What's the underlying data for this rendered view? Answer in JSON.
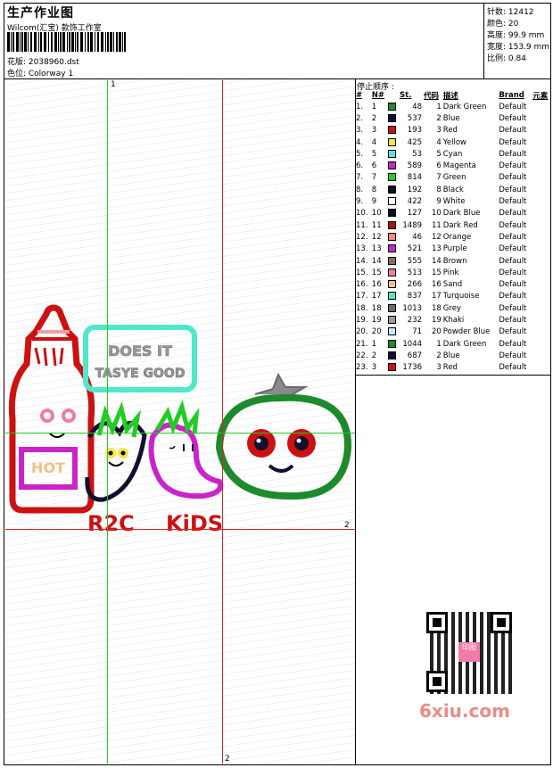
{
  "header": {
    "title": "生产作业图",
    "company": "Wilcom(汇宝) 款饰工作室",
    "design_label": "花版: 2038960.dst",
    "colorway_label": "色位: Colorway 1"
  },
  "stats": {
    "stitches": "针数: 12412",
    "colors": "颜色: 20",
    "height": "高度: 99.9 mm",
    "width": "宽度: 153.9 mm",
    "scale": "比例: 0.84"
  },
  "guides": {
    "green_v_label": "1",
    "red_h_label": "2",
    "red_v_label": "2"
  },
  "artwork": {
    "bottle_text": "HOT",
    "bubble_line1": "DOES IT",
    "bubble_line2": "TASYE GOOD",
    "brand_left": "R2C",
    "brand_right": "KiDS"
  },
  "stop_sequence": {
    "title": "停止顺序 :",
    "headers": [
      "#",
      "N#",
      "St.",
      "代码",
      "描述",
      "Brand",
      "元素"
    ],
    "rows": [
      {
        "idx": "1.",
        "n": "1",
        "color": "#1e8a2e",
        "st": "48",
        "code": "1",
        "desc": "Dark Green",
        "brand": "Default"
      },
      {
        "idx": "2.",
        "n": "2",
        "color": "#101030",
        "st": "537",
        "code": "2",
        "desc": "Blue",
        "brand": "Default"
      },
      {
        "idx": "3.",
        "n": "3",
        "color": "#cc1111",
        "st": "193",
        "code": "3",
        "desc": "Red",
        "brand": "Default"
      },
      {
        "idx": "4.",
        "n": "4",
        "color": "#f5e63c",
        "st": "425",
        "code": "4",
        "desc": "Yellow",
        "brand": "Default"
      },
      {
        "idx": "5.",
        "n": "5",
        "color": "#4fe8d8",
        "st": "53",
        "code": "5",
        "desc": "Cyan",
        "brand": "Default"
      },
      {
        "idx": "6.",
        "n": "6",
        "color": "#cc22cc",
        "st": "589",
        "code": "6",
        "desc": "Magenta",
        "brand": "Default"
      },
      {
        "idx": "7.",
        "n": "7",
        "color": "#22cc22",
        "st": "814",
        "code": "7",
        "desc": "Green",
        "brand": "Default"
      },
      {
        "idx": "8.",
        "n": "8",
        "color": "#111122",
        "st": "192",
        "code": "8",
        "desc": "Black",
        "brand": "Default"
      },
      {
        "idx": "9.",
        "n": "9",
        "color": "#ffffff",
        "st": "422",
        "code": "9",
        "desc": "White",
        "brand": "Default"
      },
      {
        "idx": "10.",
        "n": "10",
        "color": "#0c0c2a",
        "st": "127",
        "code": "10",
        "desc": "Dark Blue",
        "brand": "Default"
      },
      {
        "idx": "11.",
        "n": "11",
        "color": "#aa1111",
        "st": "1489",
        "code": "11",
        "desc": "Dark Red",
        "brand": "Default"
      },
      {
        "idx": "12.",
        "n": "12",
        "color": "#f08a78",
        "st": "46",
        "code": "12",
        "desc": "Orange",
        "brand": "Default"
      },
      {
        "idx": "13.",
        "n": "13",
        "color": "#cc22cc",
        "st": "521",
        "code": "13",
        "desc": "Purple",
        "brand": "Default"
      },
      {
        "idx": "14.",
        "n": "14",
        "color": "#8a6a58",
        "st": "555",
        "code": "14",
        "desc": "Brown",
        "brand": "Default"
      },
      {
        "idx": "15.",
        "n": "15",
        "color": "#f07aa8",
        "st": "513",
        "code": "15",
        "desc": "Pink",
        "brand": "Default"
      },
      {
        "idx": "16.",
        "n": "16",
        "color": "#f0c08a",
        "st": "266",
        "code": "16",
        "desc": "Sand",
        "brand": "Default"
      },
      {
        "idx": "17.",
        "n": "17",
        "color": "#4fe8c8",
        "st": "837",
        "code": "17",
        "desc": "Turquoise",
        "brand": "Default"
      },
      {
        "idx": "18.",
        "n": "18",
        "color": "#6a6a6a",
        "st": "1013",
        "code": "18",
        "desc": "Grey",
        "brand": "Default"
      },
      {
        "idx": "19.",
        "n": "19",
        "color": "#9a9a9a",
        "st": "232",
        "code": "19",
        "desc": "Khaki",
        "brand": "Default"
      },
      {
        "idx": "20.",
        "n": "20",
        "color": "#c8e8ff",
        "st": "71",
        "code": "20",
        "desc": "Powder Blue",
        "brand": "Default"
      },
      {
        "idx": "21.",
        "n": "1",
        "color": "#1e8a2e",
        "st": "1044",
        "code": "1",
        "desc": "Dark Green",
        "brand": "Default"
      },
      {
        "idx": "22.",
        "n": "2",
        "color": "#101030",
        "st": "687",
        "code": "2",
        "desc": "Blue",
        "brand": "Default"
      },
      {
        "idx": "23.",
        "n": "3",
        "color": "#cc1111",
        "st": "1736",
        "code": "3",
        "desc": "Red",
        "brand": "Default"
      }
    ]
  },
  "watermark": {
    "site": "6xiu.com",
    "seal": "印图"
  }
}
